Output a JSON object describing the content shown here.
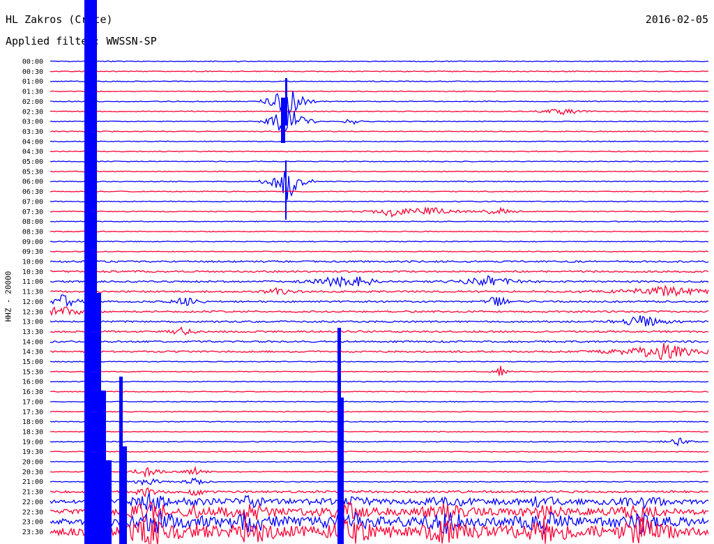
{
  "header": {
    "station_title": "HL Zakros (Crete)",
    "date": "2016-02-05",
    "filter_text": "Applied filter: WWSSN-SP"
  },
  "chart_data": {
    "type": "line",
    "title": "HL Zakros (Crete)",
    "ylabel": "HHZ - 20000",
    "row_labels": [
      "00:00",
      "00:30",
      "01:00",
      "01:30",
      "02:00",
      "02:30",
      "03:00",
      "03:30",
      "04:00",
      "04:30",
      "05:00",
      "05:30",
      "06:00",
      "06:30",
      "07:00",
      "07:30",
      "08:00",
      "08:30",
      "09:00",
      "09:30",
      "10:00",
      "10:30",
      "11:00",
      "11:30",
      "12:00",
      "12:30",
      "13:00",
      "13:30",
      "14:00",
      "14:30",
      "15:00",
      "15:30",
      "16:00",
      "16:30",
      "17:00",
      "17:30",
      "18:00",
      "18:30",
      "19:00",
      "19:30",
      "20:00",
      "20:30",
      "21:00",
      "21:30",
      "22:00",
      "22:30",
      "23:00",
      "23:30"
    ],
    "trace_colors": [
      "#0000ff",
      "#ff0033"
    ],
    "minutes_per_row": 30
  }
}
